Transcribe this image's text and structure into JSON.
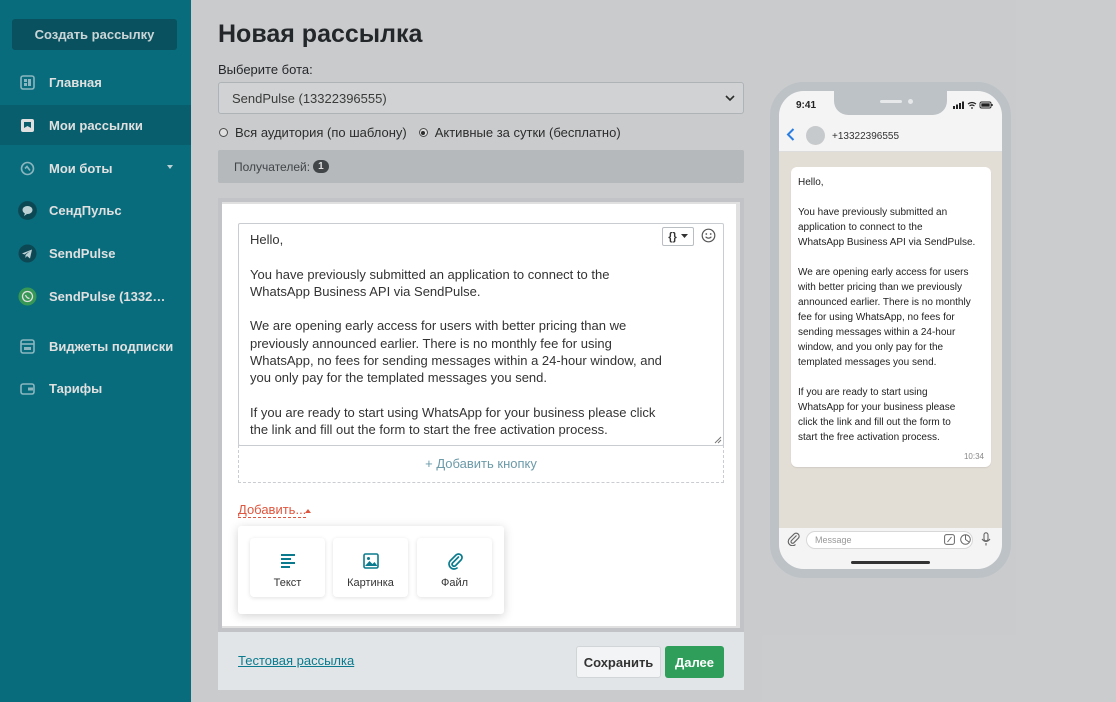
{
  "colors": {
    "sidebar": "#0a7b8e",
    "accent": "#0a7b8e",
    "primary_button": "#2f9e5b",
    "add_link": "#e0553d"
  },
  "sidebar": {
    "create_label": "Создать рассылку",
    "items": [
      {
        "label": "Главная",
        "icon": "home-icon"
      },
      {
        "label": "Мои рассылки",
        "icon": "mailing-icon"
      },
      {
        "label": "Мои боты",
        "icon": "bots-icon"
      },
      {
        "label": "СендПульс",
        "icon": "messenger-icon"
      },
      {
        "label": "SendPulse",
        "icon": "telegram-icon"
      },
      {
        "label": "SendPulse (1332…",
        "icon": "whatsapp-icon"
      },
      {
        "label": "Виджеты подписки",
        "icon": "widget-icon"
      },
      {
        "label": "Тарифы",
        "icon": "wallet-icon"
      }
    ]
  },
  "main": {
    "title": "Новая рассылка",
    "bot_label": "Выберите бота:",
    "bot_selected": "SendPulse (13322396555)",
    "radios": [
      {
        "label": "Вся аудитория (по шаблону)",
        "checked": false
      },
      {
        "label": "Активные за сутки (бесплатно)",
        "checked": true
      }
    ],
    "recipients_label": "Получателей:",
    "recipients_count": "1",
    "message": "Hello,\n\nYou have previously submitted an application to connect to the\nWhatsApp Business API via SendPulse.\n\nWe are opening early access for users with better pricing than we\npreviously announced earlier. There is no monthly fee for using\nWhatsApp, no fees for sending messages within a 24-hour window, and\nyou only pay for the templated messages you send.\n\nIf you are ready to start using WhatsApp for your business please click\nthe link and fill out the form to start the free activation process.",
    "var_button": "{}",
    "add_button_label": "+ Добавить кнопку",
    "add_more_label": "Добавить...",
    "add_menu": [
      {
        "label": "Текст",
        "icon": "text-icon"
      },
      {
        "label": "Картинка",
        "icon": "image-icon"
      },
      {
        "label": "Файл",
        "icon": "file-icon"
      }
    ],
    "test_link": "Тестовая рассылка",
    "save_label": "Сохранить",
    "next_label": "Далее"
  },
  "phone": {
    "time": "9:41",
    "contact": "+13322396555",
    "bubble_text": "Hello,\n\nYou have previously submitted an\napplication to connect to the\nWhatsApp Business API via SendPulse.\n\nWe are opening early access for users\nwith better pricing than we previously\nannounced earlier. There is no monthly\nfee for using WhatsApp, no fees for\nsending messages within a 24-hour\nwindow, and you only pay for the\ntemplated messages you send.\n\nIf you are ready to start using\nWhatsApp for your business please\nclick the link and fill out the form to\nstart the free activation process.",
    "bubble_time": "10:34",
    "input_placeholder": "Message"
  }
}
